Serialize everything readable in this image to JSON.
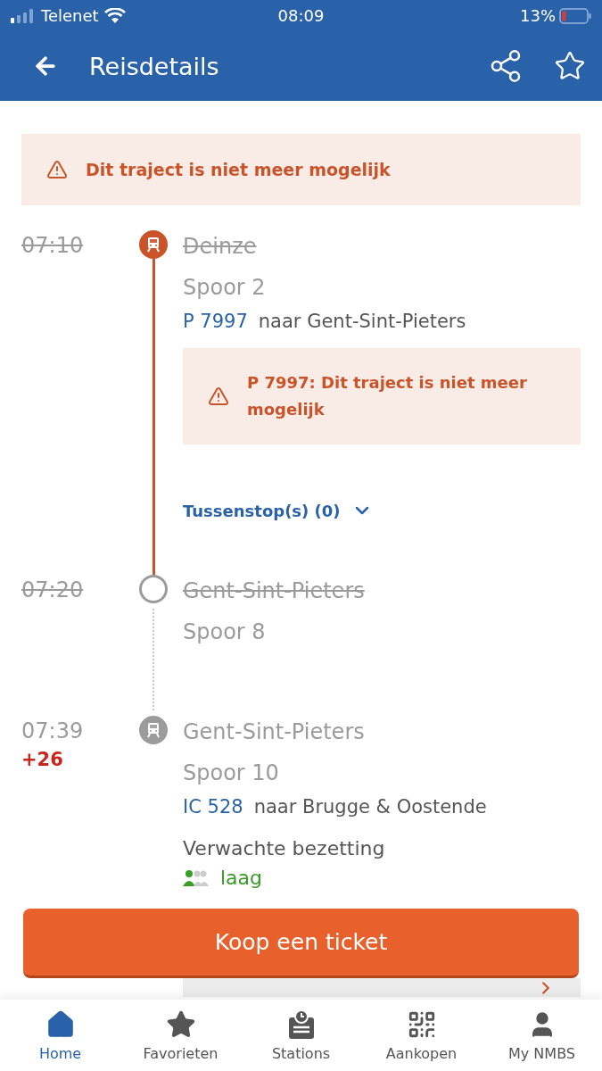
{
  "status_bar": {
    "carrier": "Telenet",
    "time": "08:09",
    "battery": "13%"
  },
  "header": {
    "title": "Reisdetails"
  },
  "notice": "Dit traject is niet meer mogelijk",
  "stops": [
    {
      "kind": "cancelled",
      "time": "07:10",
      "cancelled": true,
      "station": "Deinze",
      "platform": "Spoor 2",
      "train": "P 7997",
      "direction": "naar Gent-Sint-Pieters",
      "alert": "P 7997: Dit traject is niet meer mogelijk",
      "stopovers": {
        "label": "Tussenstop(s) (0)",
        "expanded": false
      }
    },
    {
      "kind": "transfer",
      "time": "07:20",
      "cancelled": true,
      "station": "Gent-Sint-Pieters",
      "platform": "Spoor 8"
    },
    {
      "kind": "train",
      "time": "07:39",
      "delay": "+26",
      "cancelled": false,
      "station": "Gent-Sint-Pieters",
      "platform": "Spoor 10",
      "train": "IC 528",
      "direction": "naar Brugge & Oostende",
      "occupancy": {
        "label": "Verwachte bezetting",
        "value": "laag"
      }
    }
  ],
  "buy_button": "Koop een ticket",
  "nav": [
    {
      "label": "Home",
      "selected": true
    },
    {
      "label": "Favorieten",
      "selected": false
    },
    {
      "label": "Stations",
      "selected": false
    },
    {
      "label": "Aankopen",
      "selected": false
    },
    {
      "label": "My NMBS",
      "selected": false
    }
  ]
}
